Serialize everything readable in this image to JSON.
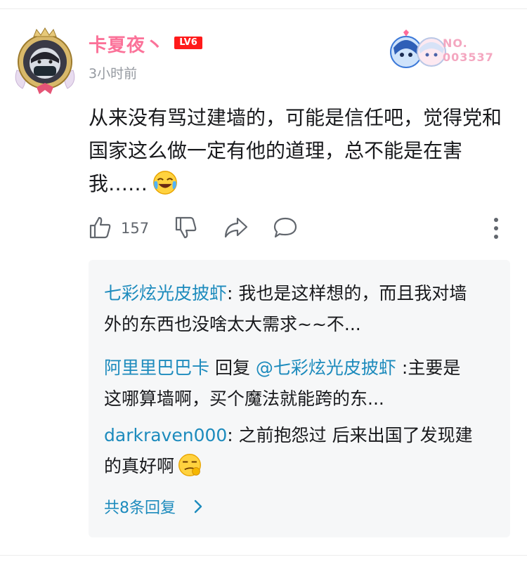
{
  "comment": {
    "username": "卡夏夜丶",
    "level_badge": "LV6",
    "time": "3小时前",
    "fan_badge_number": "NO.\n003537",
    "text": "从来没有骂过建墙的，可能是信任吧，觉得党和国家这么做一定有他的道理，总不能是在害我……",
    "like_count": "157",
    "avatar_icon": "avatar-frame-icon",
    "inline_emoji": "laughing-crying-emoji"
  },
  "replies": [
    {
      "author": "七彩炫光皮披虾",
      "separator": ": ",
      "text": "我也是这样想的，而且我对墙外的东西也没啥太大需求~~不..."
    },
    {
      "author": "阿里里巴巴卡",
      "reply_word": " 回复 ",
      "reply_to": "@七彩炫光皮披虾",
      "separator": " :",
      "text": "主要是这哪算墙啊，买个魔法就能跨的东..."
    },
    {
      "author": "darkraven000",
      "separator": ": ",
      "text": "之前抱怨过 后来出国了发现建的真好啊"
    }
  ],
  "total_replies": "共8条回复",
  "colors": {
    "username": "#fb7299",
    "link": "#1d8bbd",
    "level": "#ff1a1a",
    "reply_bg": "#f6f7f8",
    "muted": "#9499a0"
  }
}
